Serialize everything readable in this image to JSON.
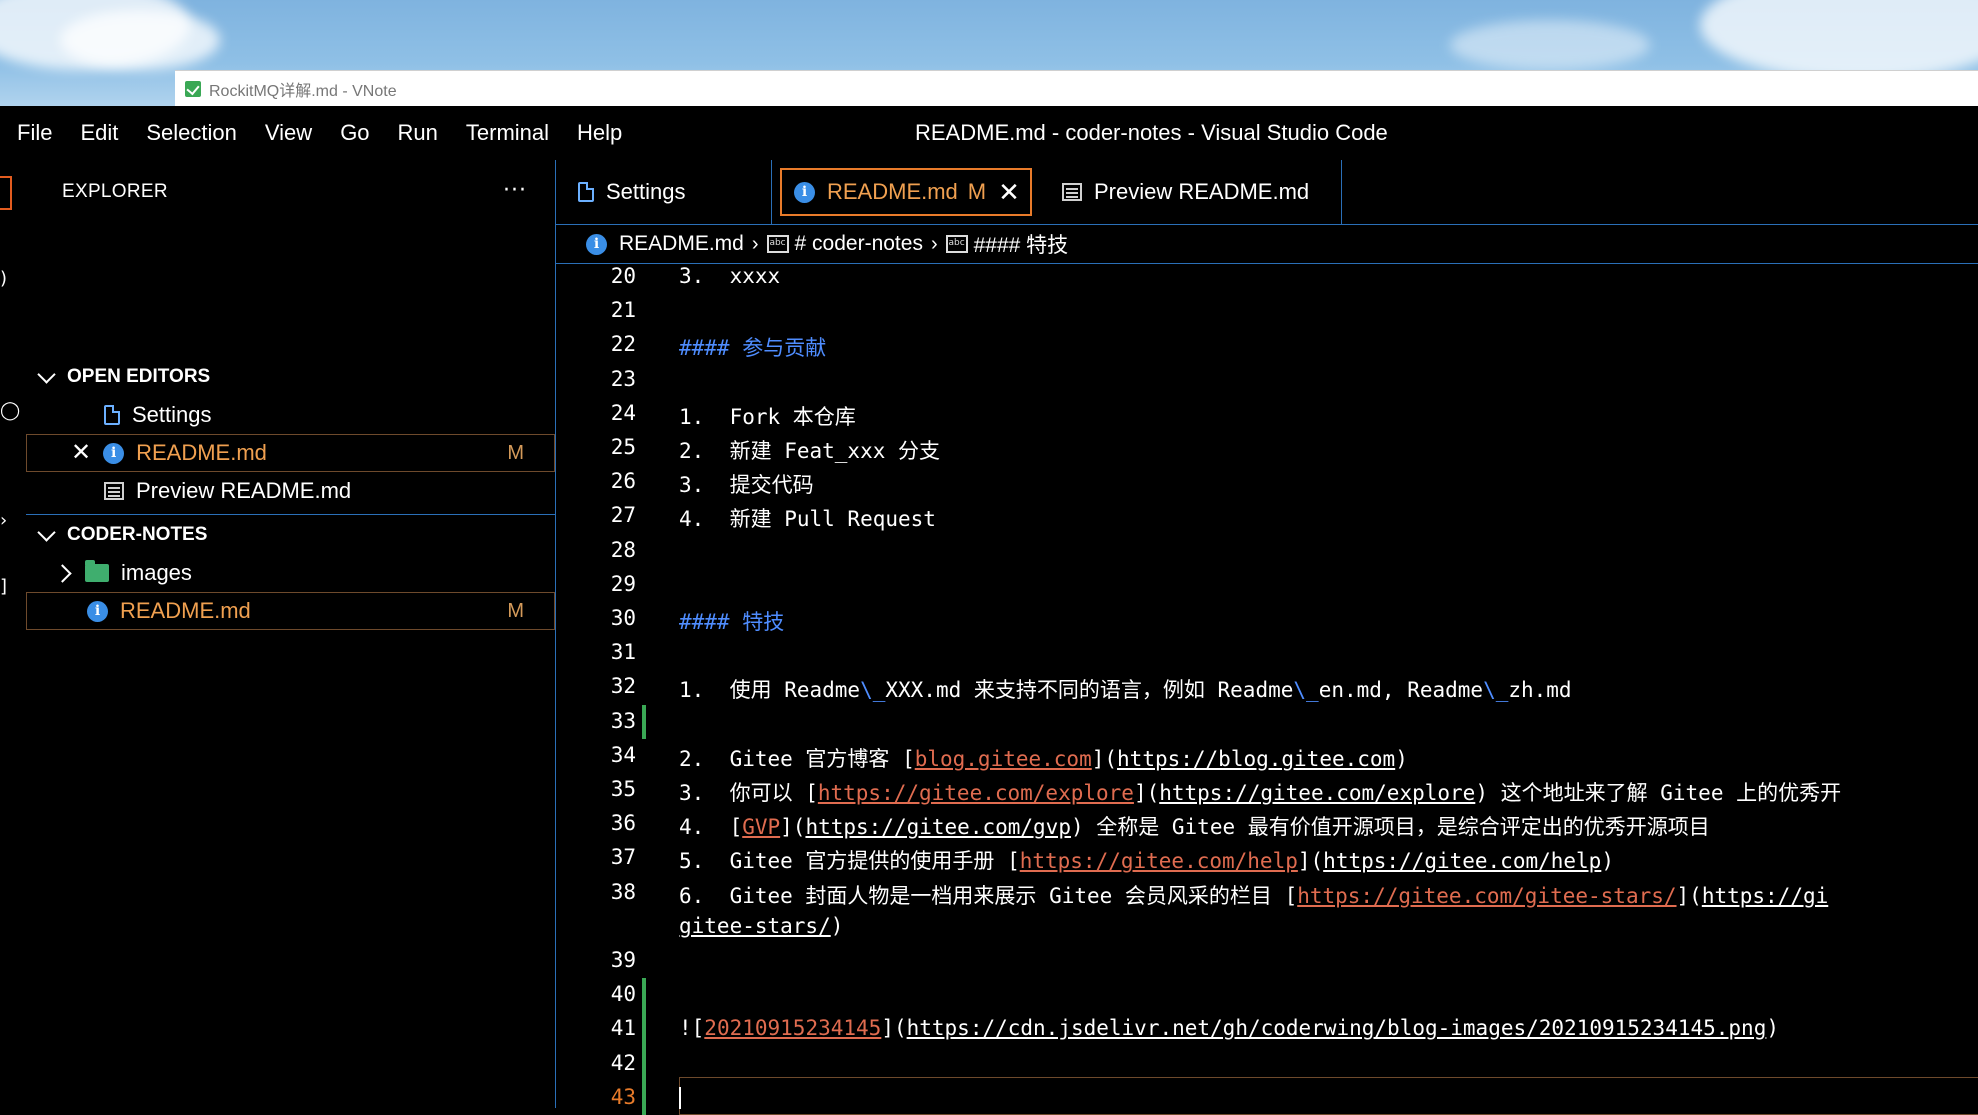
{
  "vnote": {
    "title": "RockitMQ详解.md - VNote"
  },
  "menu": [
    "File",
    "Edit",
    "Selection",
    "View",
    "Go",
    "Run",
    "Terminal",
    "Help"
  ],
  "window_title": "README.md - coder-notes - Visual Studio Code",
  "explorer": {
    "header": "EXPLORER",
    "more": "···",
    "open_editors": {
      "label": "OPEN EDITORS",
      "items": [
        {
          "name": "Settings",
          "icon": "settings-file-icon"
        },
        {
          "name": "README.md",
          "badge": "M",
          "icon": "info-icon"
        },
        {
          "name": "Preview README.md",
          "icon": "preview-icon"
        }
      ]
    },
    "workspace": {
      "label": "CODER-NOTES",
      "items": [
        {
          "name": "images",
          "icon": "images-folder-icon"
        },
        {
          "name": "README.md",
          "badge": "M",
          "icon": "info-icon"
        }
      ]
    }
  },
  "tabs": [
    {
      "label": "Settings"
    },
    {
      "label": "README.md",
      "badge": "M"
    },
    {
      "label": "Preview README.md"
    }
  ],
  "breadcrumb": [
    "README.md",
    "# coder-notes",
    "#### 特技"
  ],
  "colors": {
    "accent_border": "#2a6fb8",
    "modified": "#f0a050",
    "heading": "#4f8dff",
    "link_text": "#e06c50",
    "gutter_added": "#3aa855"
  },
  "lines": [
    {
      "n": "20",
      "t": "3.  xxxx"
    },
    {
      "n": "21",
      "t": ""
    },
    {
      "n": "22",
      "t": "#### 参与贡献"
    },
    {
      "n": "23",
      "t": ""
    },
    {
      "n": "24",
      "t": "1.  Fork 本仓库"
    },
    {
      "n": "25",
      "t": "2.  新建 Feat_xxx 分支"
    },
    {
      "n": "26",
      "t": "3.  提交代码"
    },
    {
      "n": "27",
      "t": "4.  新建 Pull Request"
    },
    {
      "n": "28",
      "t": ""
    },
    {
      "n": "29",
      "t": ""
    },
    {
      "n": "30",
      "t": "#### 特技"
    },
    {
      "n": "31",
      "t": ""
    },
    {
      "n": "32",
      "t": "1.  使用 Readme\\_XXX.md 来支持不同的语言，例如 Readme\\_en.md, Readme\\_zh.md"
    },
    {
      "n": "33",
      "t": ""
    },
    {
      "n": "34",
      "t": "2.  Gitee 官方博客 [blog.gitee.com](https://blog.gitee.com)"
    },
    {
      "n": "35",
      "t": "3.  你可以 [https://gitee.com/explore](https://gitee.com/explore) 这个地址来了解 Gitee 上的优秀开"
    },
    {
      "n": "36",
      "t": "4.  [GVP](https://gitee.com/gvp) 全称是 Gitee 最有价值开源项目，是综合评定出的优秀开源项目"
    },
    {
      "n": "37",
      "t": "5.  Gitee 官方提供的使用手册 [https://gitee.com/help](https://gitee.com/help)"
    },
    {
      "n": "38",
      "t": "6.  Gitee 封面人物是一档用来展示 Gitee 会员风采的栏目 [https://gitee.com/gitee-stars/](https://gi"
    },
    {
      "n": "",
      "t": "gitee-stars/)"
    },
    {
      "n": "39",
      "t": ""
    },
    {
      "n": "40",
      "t": ""
    },
    {
      "n": "41",
      "t": "![20210915234145](https://cdn.jsdelivr.net/gh/coderwing/blog-images/20210915234145.png)"
    },
    {
      "n": "42",
      "t": ""
    },
    {
      "n": "43",
      "t": ""
    }
  ]
}
